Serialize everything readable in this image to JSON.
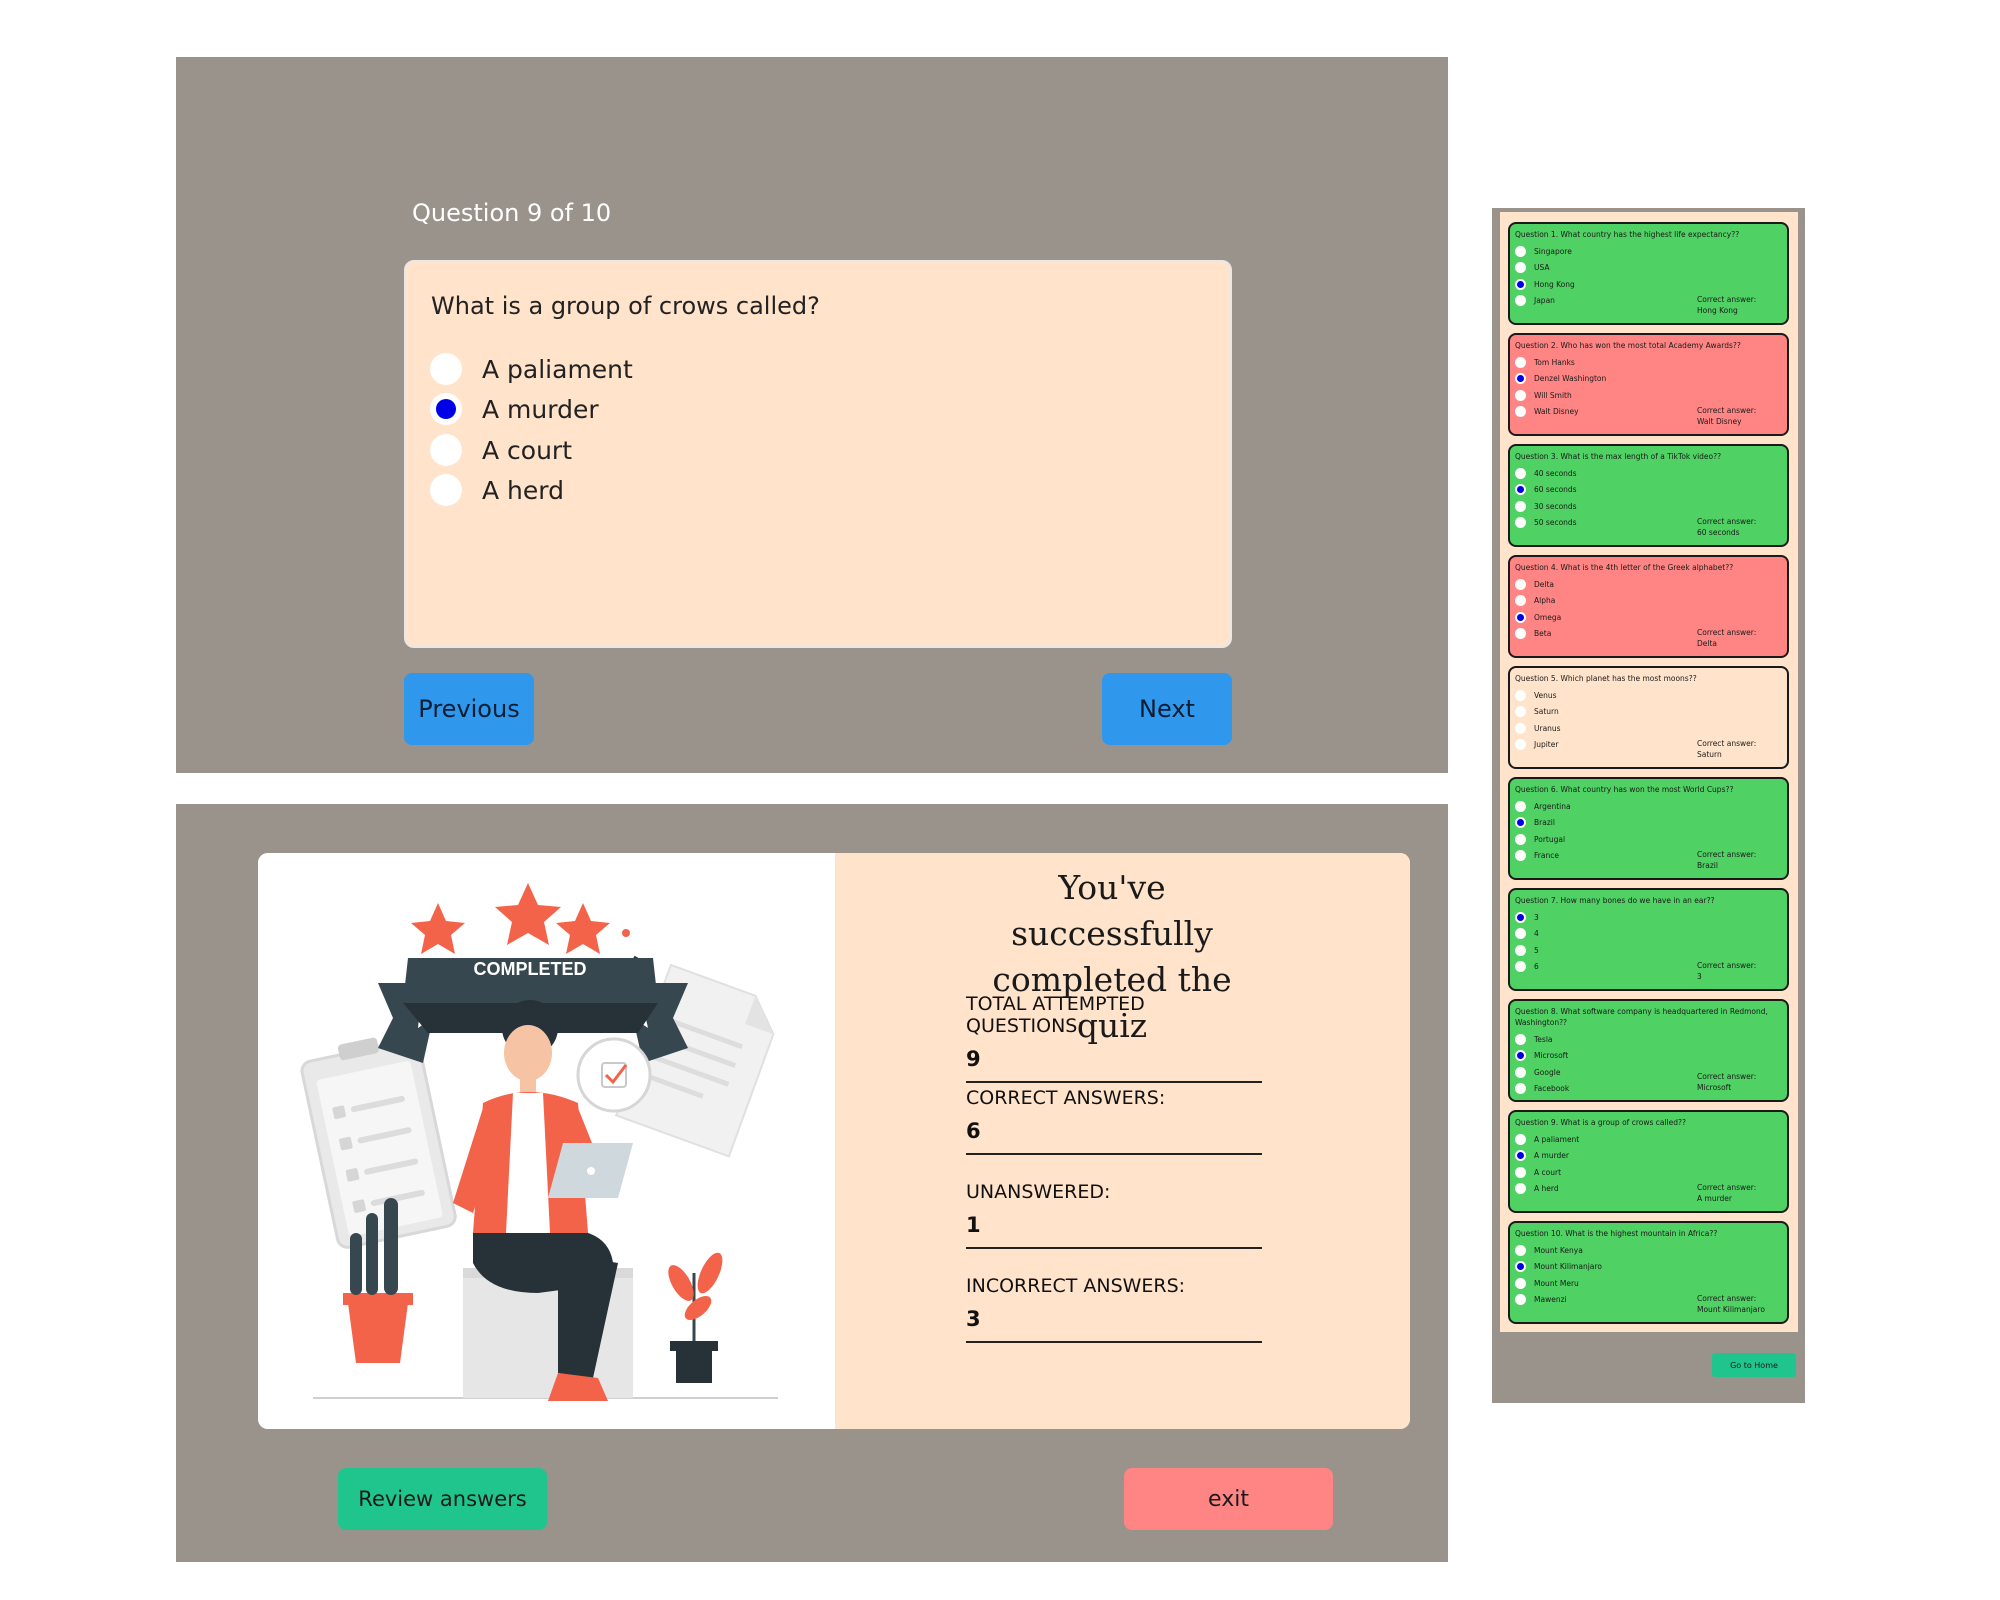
{
  "quiz": {
    "counter": "Question 9 of 10",
    "question": "What is a group of crows called?",
    "options": [
      "A paliament",
      "A murder",
      "A court",
      "A herd"
    ],
    "selected_index": 1,
    "prev_label": "Previous",
    "next_label": "Next"
  },
  "result": {
    "badge": "COMPLETED",
    "title_line1": "You've successfully",
    "title_line2": "completed the quiz",
    "stats": [
      {
        "label": "TOTAL ATTEMPTED QUESTIONS:",
        "value": "9"
      },
      {
        "label": "CORRECT ANSWERS:",
        "value": "6"
      },
      {
        "label": "UNANSWERED:",
        "value": "1"
      },
      {
        "label": "INCORRECT ANSWERS:",
        "value": "3"
      }
    ],
    "review_label": "Review answers",
    "exit_label": "exit"
  },
  "review": {
    "correct_prefix": "Correct answer:",
    "home_label": "Go to Home",
    "items": [
      {
        "title": "Question 1. What country has the highest life expectancy??",
        "options": [
          "Singapore",
          "USA",
          "Hong Kong",
          "Japan"
        ],
        "selected": 2,
        "status": "correct",
        "answer": "Hong Kong"
      },
      {
        "title": "Question 2. Who has won the most total Academy Awards??",
        "options": [
          "Tom Hanks",
          "Denzel Washington",
          "Will Smith",
          "Walt Disney"
        ],
        "selected": 1,
        "status": "incorrect",
        "answer": "Walt Disney"
      },
      {
        "title": "Question 3. What is the max length of a TikTok video??",
        "options": [
          "40 seconds",
          "60 seconds",
          "30 seconds",
          "50 seconds"
        ],
        "selected": 1,
        "status": "correct",
        "answer": "60 seconds"
      },
      {
        "title": "Question 4. What is the 4th letter of the Greek alphabet??",
        "options": [
          "Delta",
          "Alpha",
          "Omega",
          "Beta"
        ],
        "selected": 2,
        "status": "incorrect",
        "answer": "Delta"
      },
      {
        "title": "Question 5. Which planet has the most moons??",
        "options": [
          "Venus",
          "Saturn",
          "Uranus",
          "Jupiter"
        ],
        "selected": -1,
        "status": "unanswered",
        "answer": "Saturn"
      },
      {
        "title": "Question 6. What country has won the most World Cups??",
        "options": [
          "Argentina",
          "Brazil",
          "Portugal",
          "France"
        ],
        "selected": 1,
        "status": "correct",
        "answer": "Brazil"
      },
      {
        "title": "Question 7. How many bones do we have in an ear??",
        "options": [
          "3",
          "4",
          "5",
          "6"
        ],
        "selected": 0,
        "status": "correct",
        "answer": "3"
      },
      {
        "title": "Question 8. What software company is headquartered in Redmond, Washington??",
        "options": [
          "Tesla",
          "Microsoft",
          "Google",
          "Facebook"
        ],
        "selected": 1,
        "status": "correct",
        "answer": "Microsoft"
      },
      {
        "title": "Question 9. What is a group of crows called??",
        "options": [
          "A paliament",
          "A murder",
          "A court",
          "A herd"
        ],
        "selected": 1,
        "status": "correct",
        "answer": "A murder"
      },
      {
        "title": "Question 10. What is the highest mountain in Africa??",
        "options": [
          "Mount Kenya",
          "Mount Kilimanjaro",
          "Mount Meru",
          "Mawenzi"
        ],
        "selected": 1,
        "status": "correct",
        "answer": "Mount Kilimanjaro"
      }
    ]
  }
}
